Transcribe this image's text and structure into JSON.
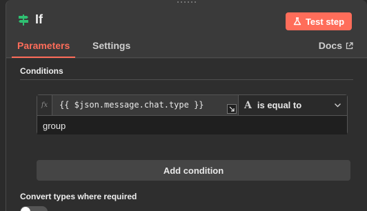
{
  "node": {
    "title": "If",
    "icon": "signpost-icon",
    "test_button_label": "Test step"
  },
  "tabs": [
    {
      "label": "Parameters",
      "active": true
    },
    {
      "label": "Settings",
      "active": false
    }
  ],
  "docs_label": "Docs",
  "conditions": {
    "title": "Conditions",
    "rows": [
      {
        "fx_label": "fx",
        "expression": "{{ $json.message.chat.type }}",
        "type_icon": "A",
        "operator": "is equal to",
        "value": "group"
      }
    ],
    "add_label": "Add condition"
  },
  "convert_types": {
    "label": "Convert types where required",
    "enabled": false
  },
  "colors": {
    "accent": "#ff6d5a",
    "node_icon": "#2fbf71"
  }
}
